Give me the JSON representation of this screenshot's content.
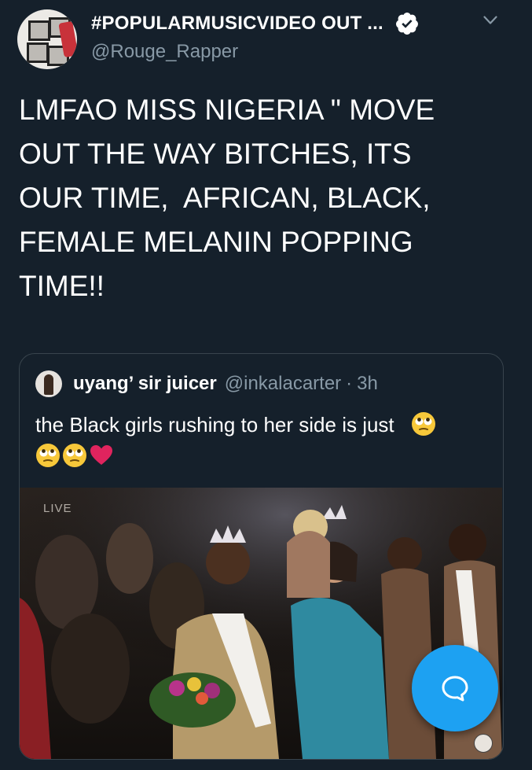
{
  "tweet": {
    "display_name": "#POPULARMUSICVIDEO OUT ...",
    "handle": "@Rouge_Rapper",
    "text": "LMFAO MISS NIGERIA \" MOVE\nOUT THE WAY BITCHES, ITS\nOUR TIME,  AFRICAN, BLACK,\nFEMALE MELANIN POPPING\nTIME!!"
  },
  "quoted": {
    "name": "uyang’ sir juicer",
    "handle": "@inkalacarter",
    "separator": "·",
    "time": "3h",
    "text": "the Black girls rushing to her side is just",
    "media": {
      "live_label": "LIVE"
    }
  },
  "icons": {
    "verified": "verified-badge-icon",
    "chevron": "chevron-down-icon",
    "emoji": "face-with-rolling-eyes-emoji",
    "heart": "red-heart-emoji",
    "compose": "compose-reply-icon"
  },
  "colors": {
    "background": "#15202b",
    "secondary_text": "#8899a6",
    "border": "#38444d",
    "accent": "#1da1f2",
    "heart": "#e0245e"
  }
}
